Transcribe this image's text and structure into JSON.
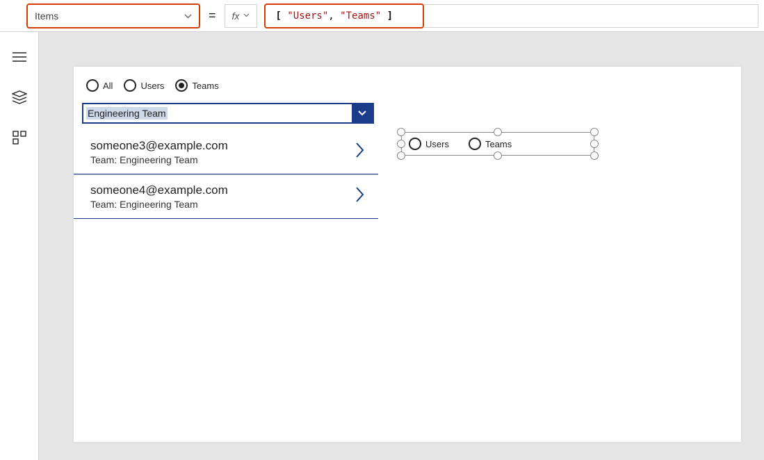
{
  "formula_bar": {
    "property": "Items",
    "fx_label": "fx",
    "formula_parts": {
      "open": "[",
      "str1": "\"Users\"",
      "sep": ",",
      "str2": "\"Teams\"",
      "close": "]"
    }
  },
  "rail": {
    "hamburger": "hamburger-icon",
    "layers": "layers-icon",
    "components": "components-icon"
  },
  "radio_main": {
    "all": "All",
    "users": "Users",
    "teams": "Teams"
  },
  "combo": {
    "value": "Engineering Team"
  },
  "results": [
    {
      "email": "someone3@example.com",
      "team": "Team: Engineering Team"
    },
    {
      "email": "someone4@example.com",
      "team": "Team: Engineering Team"
    }
  ],
  "selected_radio": {
    "users": "Users",
    "teams": "Teams"
  }
}
